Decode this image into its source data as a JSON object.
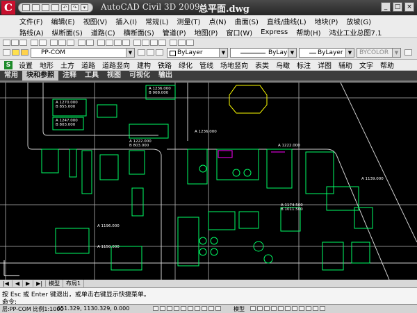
{
  "window": {
    "logo": "C",
    "app_title": "AutoCAD Civil 3D 2009",
    "doc_name": "总平面.dwg",
    "controls": [
      "_",
      "□",
      "×"
    ]
  },
  "menu_row1": [
    "文件(F)",
    "编辑(E)",
    "视图(V)",
    "插入(I)",
    "常规(L)",
    "测量(T)",
    "点(N)",
    "曲面(S)",
    "直线/曲线(L)",
    "地块(P)",
    "放坡(G)"
  ],
  "menu_row2": [
    "路线(A)",
    "纵断面(S)",
    "道路(C)",
    "横断面(S)",
    "管道(P)",
    "地图(P)",
    "窗口(W)",
    "Express",
    "帮助(H)",
    "鸿业工业总图7.1"
  ],
  "toolbar": {
    "layer_name": "PP-COM",
    "color_value": "ByLayer",
    "linetype_value": "ByLayer",
    "lineweight_value": "ByLayer",
    "plotstyle_value": "BYCOLOR"
  },
  "civil_menu": [
    "设置",
    "地形",
    "土方",
    "道路",
    "道路竖向",
    "建构",
    "铁路",
    "绿化",
    "管线",
    "场地竖向",
    "表类",
    "鸟瞰",
    "标注",
    "详图",
    "辅助",
    "文字",
    "帮助"
  ],
  "ribbon_tabs": [
    "常用",
    "块和参照",
    "注释",
    "工具",
    "视图",
    "可视化",
    "输出"
  ],
  "ribbon_active": "块和参照",
  "drawing_labels": [
    {
      "text": "A 1236.000"
    },
    {
      "text": "B 908.000"
    },
    {
      "text": "A 1270.000"
    },
    {
      "text": "B 855.000"
    },
    {
      "text": "A 1247.000"
    },
    {
      "text": "B 803.000"
    },
    {
      "text": "A 1222.000"
    },
    {
      "text": "B 803.000"
    },
    {
      "text": "A 1236.000"
    },
    {
      "text": "A 1174.500"
    },
    {
      "text": "B 1011.500"
    },
    {
      "text": "A 1196.000"
    },
    {
      "text": "A 1150.000"
    },
    {
      "text": "A 1139.000"
    },
    {
      "text": "A 1222.000"
    }
  ],
  "model_tabs": [
    "模型",
    "布局1"
  ],
  "command": {
    "line1": "按 Esc 或 Enter 键退出，或单击右键显示快捷菜单。",
    "line2": "命令:"
  },
  "status": {
    "layer_scale": "层:PP-COM 比例1:1000",
    "coords": "651.329, 1130.329, 0.000",
    "model": "模型"
  },
  "colors": {
    "drawing_bg": "#000000",
    "geometry": "#00ff66",
    "grid": "#b4b4b4",
    "label": "#ffffff",
    "accent_yellow": "#ffff00",
    "accent_magenta": "#ff00ff"
  }
}
